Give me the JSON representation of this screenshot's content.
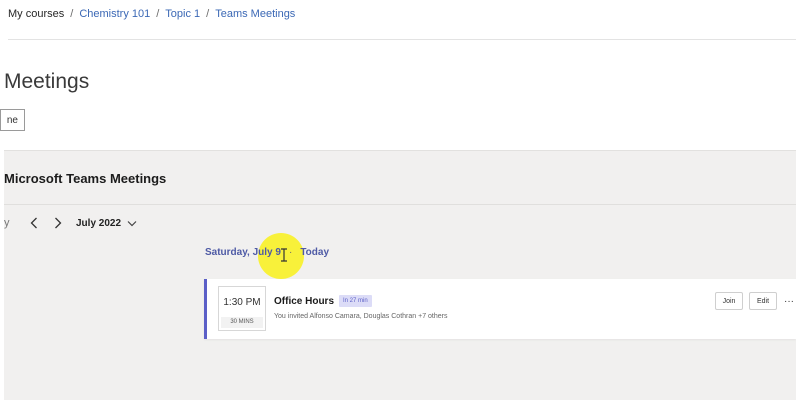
{
  "breadcrumb": {
    "items": [
      "My courses",
      "Chemistry 101",
      "Topic 1",
      "Teams Meetings"
    ],
    "separator": "/"
  },
  "page": {
    "title": "Meetings",
    "button_label": "ne"
  },
  "teams": {
    "title": "Microsoft Teams Meetings",
    "nav": {
      "today_cut": "y",
      "month_label": "July 2022"
    },
    "date_header": {
      "date_label": "Saturday, July 9",
      "dot": "·",
      "today_link": "Today"
    },
    "meeting": {
      "time": "1:30 PM",
      "duration": "30 MINS",
      "title": "Office Hours",
      "badge": "In 27 min",
      "invite_text": "You invited Alfonso Camara, Douglas Cothran +7 others",
      "join_label": "Join",
      "edit_label": "Edit",
      "more_label": "···"
    }
  },
  "colors": {
    "accent": "#5b5fc7",
    "link": "#3b68b5",
    "highlight": "#f8f12a"
  }
}
